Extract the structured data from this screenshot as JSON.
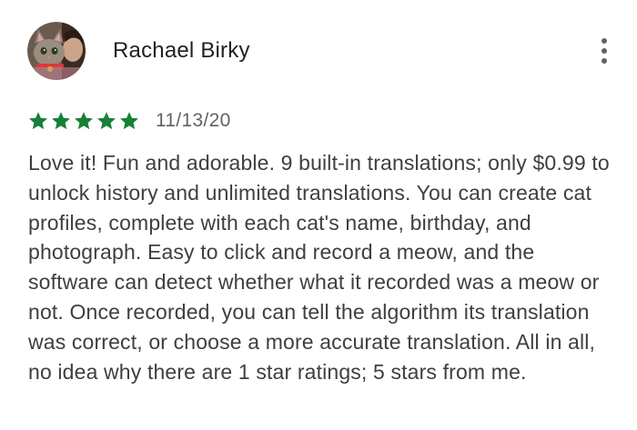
{
  "review": {
    "author_name": "Rachael Birky",
    "avatar_icon": "cat-avatar-icon",
    "more_icon": "more-vert-icon",
    "rating": 5,
    "rating_max": 5,
    "star_icon": "star-icon",
    "date": "11/13/20",
    "text": "Love it! Fun and adorable. 9 built-in translations; only $0.99 to unlock history and unlimited translations. You can create cat profiles, complete with each cat's name, birthday, and photograph. Easy to click and record a meow, and the software can detect whether what it recorded was a meow or not. Once recorded, you can tell the algorithm its translation was correct, or choose a more accurate translation. All in all, no idea why there are 1 star ratings; 5 stars from me."
  },
  "colors": {
    "star": "#188038",
    "author_text": "#202124",
    "date_text": "#5f6368",
    "body_text": "#3c4043",
    "more_icon": "#5f6368"
  }
}
